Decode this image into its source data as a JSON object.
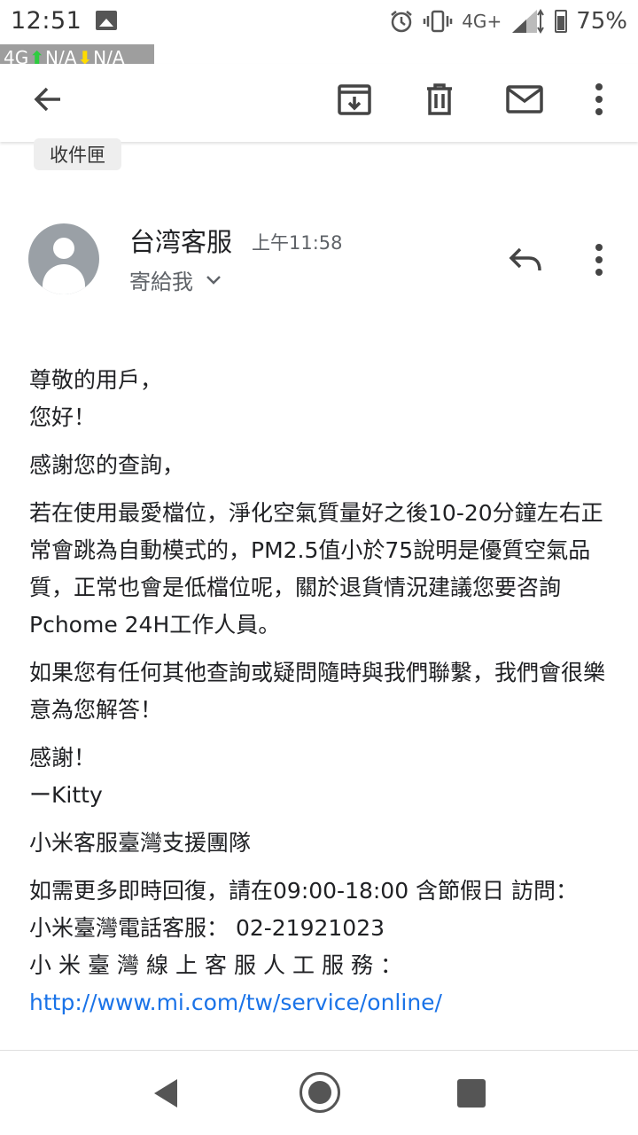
{
  "status_bar": {
    "time": "12:51",
    "network": "4G",
    "network_plus": "+",
    "battery": "75%"
  },
  "net_speed": {
    "network": "4G",
    "up": "N/A",
    "down": "N/A"
  },
  "toolbar": {
    "back_icon": "arrow-left-icon",
    "archive_icon": "archive-icon",
    "delete_icon": "trash-icon",
    "mark_unread_icon": "mail-icon",
    "more_icon": "more-vert-icon"
  },
  "label": "收件匣",
  "message": {
    "sender": "台湾客服",
    "time": "上午11:58",
    "recipient": "寄給我",
    "body": {
      "greeting_1": "尊敬的用戶，",
      "greeting_2": "您好！",
      "thanks": "感謝您的查詢，",
      "para_1": "若在使用最愛檔位，淨化空氣質量好之後10-20分鐘左右正常會跳為自動模式的，PM2.5值小於75說明是優質空氣品質，正常也會是低檔位呢，關於退貨情況建議您要咨詢Pchome 24H工作人員。",
      "para_2": "如果您有任何其他查詢或疑問隨時與我們聯繫，我們會很樂意為您解答！",
      "closing": "感謝！",
      "signature": "ーKitty",
      "team": "小米客服臺灣支援團隊",
      "hours": "如需更多即時回復，請在09:00-18:00 含節假日 訪問：",
      "phone": "小米臺灣電話客服： 02-21921023",
      "online_label": "小米臺灣線上客服人工服務：",
      "online_url": "http://www.mi.com/tw/service/online/"
    }
  },
  "colors": {
    "link": "#1a73e8",
    "avatar": "#9aa0a6",
    "chip": "#eeeeee"
  }
}
